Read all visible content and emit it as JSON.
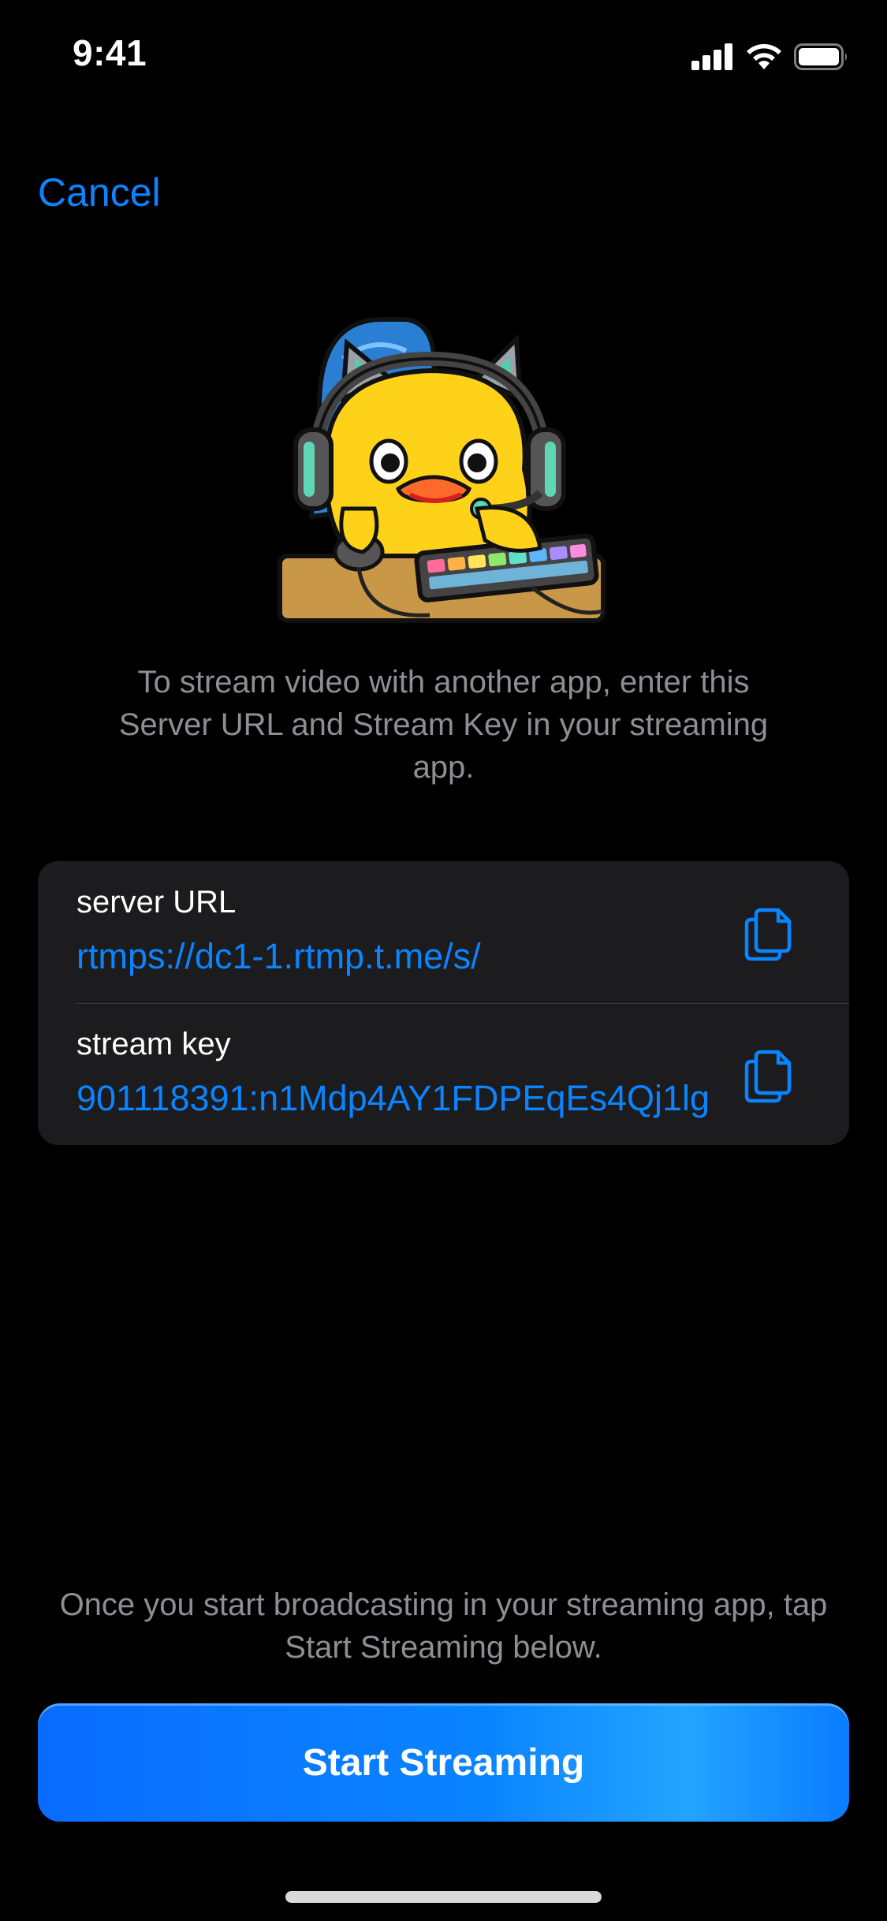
{
  "status_bar": {
    "time": "9:41",
    "icons": [
      "cellular-signal-icon",
      "wifi-icon",
      "battery-icon"
    ]
  },
  "nav": {
    "cancel_label": "Cancel"
  },
  "illustration": {
    "name": "duck-streamer-illustration"
  },
  "instructions": "To stream video with another app, enter this Server URL and Stream Key in your streaming app.",
  "credentials": {
    "server_url": {
      "label": "server URL",
      "value": "rtmps://dc1-1.rtmp.t.me/s/",
      "icon": "copy-icon"
    },
    "stream_key": {
      "label": "stream key",
      "value": "901118391:n1Mdp4AY1FDPEqEs4Qj1lg",
      "icon": "copy-icon"
    }
  },
  "footer_note": "Once you start broadcasting in your streaming app, tap Start Streaming below.",
  "primary_button": {
    "label": "Start Streaming"
  },
  "colors": {
    "accent": "#0a84ff",
    "background": "#000000",
    "card": "#1c1c1e",
    "secondary_text": "#8e8e93"
  }
}
